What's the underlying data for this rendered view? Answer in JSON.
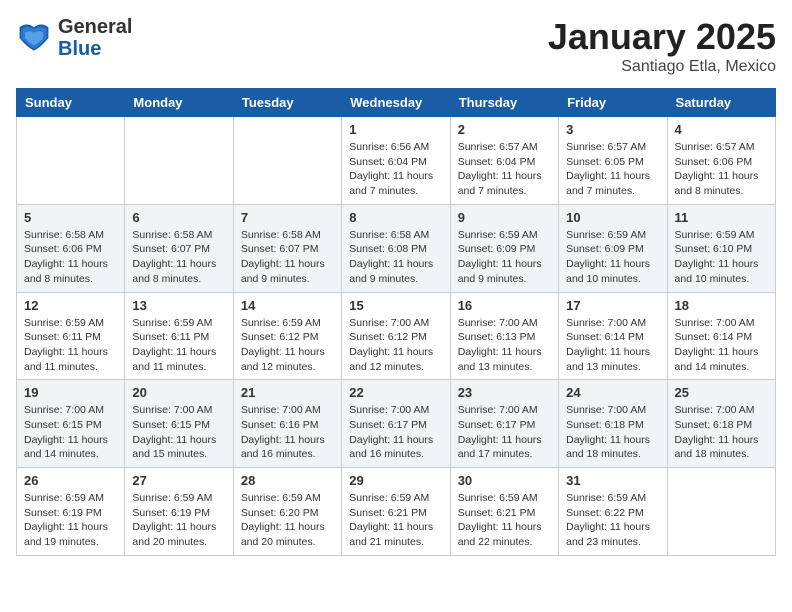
{
  "header": {
    "logo_general": "General",
    "logo_blue": "Blue",
    "title": "January 2025",
    "subtitle": "Santiago Etla, Mexico"
  },
  "weekdays": [
    "Sunday",
    "Monday",
    "Tuesday",
    "Wednesday",
    "Thursday",
    "Friday",
    "Saturday"
  ],
  "weeks": [
    [
      null,
      null,
      null,
      {
        "day": 1,
        "sunrise": "6:56 AM",
        "sunset": "6:04 PM",
        "daylight": "11 hours and 7 minutes."
      },
      {
        "day": 2,
        "sunrise": "6:57 AM",
        "sunset": "6:04 PM",
        "daylight": "11 hours and 7 minutes."
      },
      {
        "day": 3,
        "sunrise": "6:57 AM",
        "sunset": "6:05 PM",
        "daylight": "11 hours and 7 minutes."
      },
      {
        "day": 4,
        "sunrise": "6:57 AM",
        "sunset": "6:06 PM",
        "daylight": "11 hours and 8 minutes."
      }
    ],
    [
      {
        "day": 5,
        "sunrise": "6:58 AM",
        "sunset": "6:06 PM",
        "daylight": "11 hours and 8 minutes."
      },
      {
        "day": 6,
        "sunrise": "6:58 AM",
        "sunset": "6:07 PM",
        "daylight": "11 hours and 8 minutes."
      },
      {
        "day": 7,
        "sunrise": "6:58 AM",
        "sunset": "6:07 PM",
        "daylight": "11 hours and 9 minutes."
      },
      {
        "day": 8,
        "sunrise": "6:58 AM",
        "sunset": "6:08 PM",
        "daylight": "11 hours and 9 minutes."
      },
      {
        "day": 9,
        "sunrise": "6:59 AM",
        "sunset": "6:09 PM",
        "daylight": "11 hours and 9 minutes."
      },
      {
        "day": 10,
        "sunrise": "6:59 AM",
        "sunset": "6:09 PM",
        "daylight": "11 hours and 10 minutes."
      },
      {
        "day": 11,
        "sunrise": "6:59 AM",
        "sunset": "6:10 PM",
        "daylight": "11 hours and 10 minutes."
      }
    ],
    [
      {
        "day": 12,
        "sunrise": "6:59 AM",
        "sunset": "6:11 PM",
        "daylight": "11 hours and 11 minutes."
      },
      {
        "day": 13,
        "sunrise": "6:59 AM",
        "sunset": "6:11 PM",
        "daylight": "11 hours and 11 minutes."
      },
      {
        "day": 14,
        "sunrise": "6:59 AM",
        "sunset": "6:12 PM",
        "daylight": "11 hours and 12 minutes."
      },
      {
        "day": 15,
        "sunrise": "7:00 AM",
        "sunset": "6:12 PM",
        "daylight": "11 hours and 12 minutes."
      },
      {
        "day": 16,
        "sunrise": "7:00 AM",
        "sunset": "6:13 PM",
        "daylight": "11 hours and 13 minutes."
      },
      {
        "day": 17,
        "sunrise": "7:00 AM",
        "sunset": "6:14 PM",
        "daylight": "11 hours and 13 minutes."
      },
      {
        "day": 18,
        "sunrise": "7:00 AM",
        "sunset": "6:14 PM",
        "daylight": "11 hours and 14 minutes."
      }
    ],
    [
      {
        "day": 19,
        "sunrise": "7:00 AM",
        "sunset": "6:15 PM",
        "daylight": "11 hours and 14 minutes."
      },
      {
        "day": 20,
        "sunrise": "7:00 AM",
        "sunset": "6:15 PM",
        "daylight": "11 hours and 15 minutes."
      },
      {
        "day": 21,
        "sunrise": "7:00 AM",
        "sunset": "6:16 PM",
        "daylight": "11 hours and 16 minutes."
      },
      {
        "day": 22,
        "sunrise": "7:00 AM",
        "sunset": "6:17 PM",
        "daylight": "11 hours and 16 minutes."
      },
      {
        "day": 23,
        "sunrise": "7:00 AM",
        "sunset": "6:17 PM",
        "daylight": "11 hours and 17 minutes."
      },
      {
        "day": 24,
        "sunrise": "7:00 AM",
        "sunset": "6:18 PM",
        "daylight": "11 hours and 18 minutes."
      },
      {
        "day": 25,
        "sunrise": "7:00 AM",
        "sunset": "6:18 PM",
        "daylight": "11 hours and 18 minutes."
      }
    ],
    [
      {
        "day": 26,
        "sunrise": "6:59 AM",
        "sunset": "6:19 PM",
        "daylight": "11 hours and 19 minutes."
      },
      {
        "day": 27,
        "sunrise": "6:59 AM",
        "sunset": "6:19 PM",
        "daylight": "11 hours and 20 minutes."
      },
      {
        "day": 28,
        "sunrise": "6:59 AM",
        "sunset": "6:20 PM",
        "daylight": "11 hours and 20 minutes."
      },
      {
        "day": 29,
        "sunrise": "6:59 AM",
        "sunset": "6:21 PM",
        "daylight": "11 hours and 21 minutes."
      },
      {
        "day": 30,
        "sunrise": "6:59 AM",
        "sunset": "6:21 PM",
        "daylight": "11 hours and 22 minutes."
      },
      {
        "day": 31,
        "sunrise": "6:59 AM",
        "sunset": "6:22 PM",
        "daylight": "11 hours and 23 minutes."
      },
      null
    ]
  ],
  "labels": {
    "sunrise": "Sunrise:",
    "sunset": "Sunset:",
    "daylight": "Daylight:"
  }
}
